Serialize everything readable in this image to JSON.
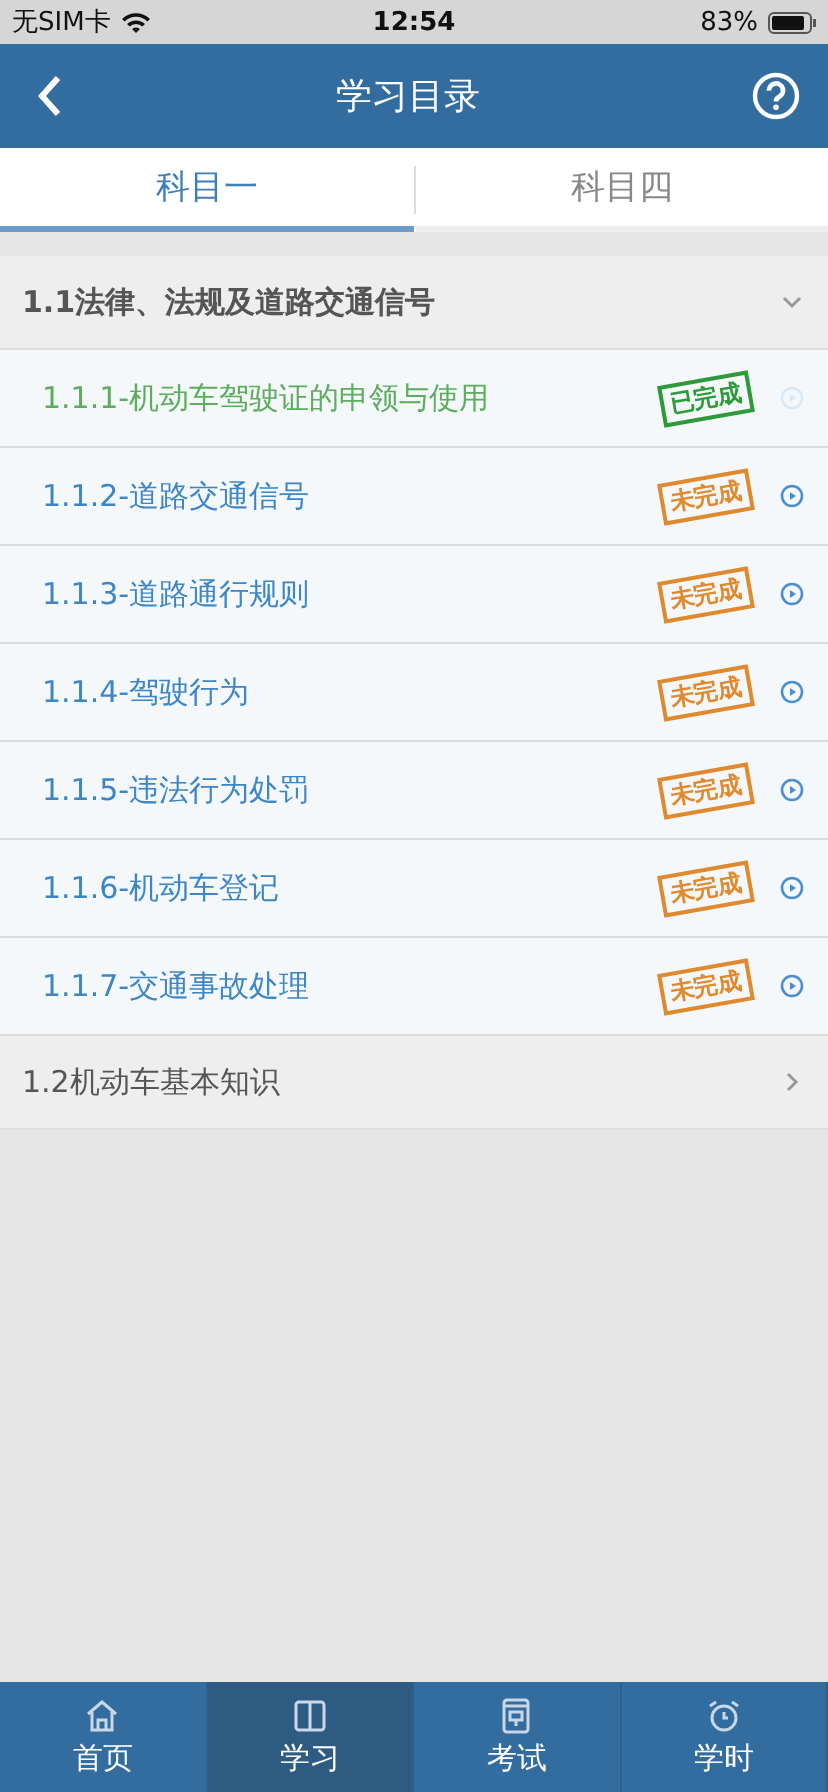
{
  "status_bar": {
    "carrier": "无SIM卡",
    "time": "12:54",
    "battery": "83%"
  },
  "header": {
    "title": "学习目录"
  },
  "tabs": [
    {
      "label": "科目一",
      "selected": true
    },
    {
      "label": "科目四",
      "selected": false
    }
  ],
  "sections": [
    {
      "title": "1.1法律、法规及道路交通信号",
      "expanded": true,
      "children": [
        {
          "title": "1.1.1-机动车驾驶证的申领与使用",
          "done": true,
          "stamp": "已完成"
        },
        {
          "title": "1.1.2-道路交通信号",
          "done": false,
          "stamp": "未完成"
        },
        {
          "title": "1.1.3-道路通行规则",
          "done": false,
          "stamp": "未完成"
        },
        {
          "title": "1.1.4-驾驶行为",
          "done": false,
          "stamp": "未完成"
        },
        {
          "title": "1.1.5-违法行为处罚",
          "done": false,
          "stamp": "未完成"
        },
        {
          "title": "1.1.6-机动车登记",
          "done": false,
          "stamp": "未完成"
        },
        {
          "title": "1.1.7-交通事故处理",
          "done": false,
          "stamp": "未完成"
        }
      ]
    },
    {
      "title": "1.2机动车基本知识",
      "expanded": false
    }
  ],
  "tab_bar": [
    {
      "label": "首页",
      "kind": "home",
      "selected": false
    },
    {
      "label": "学习",
      "kind": "book",
      "selected": true
    },
    {
      "label": "考试",
      "kind": "exam",
      "selected": false
    },
    {
      "label": "学时",
      "kind": "clock",
      "selected": false
    }
  ]
}
